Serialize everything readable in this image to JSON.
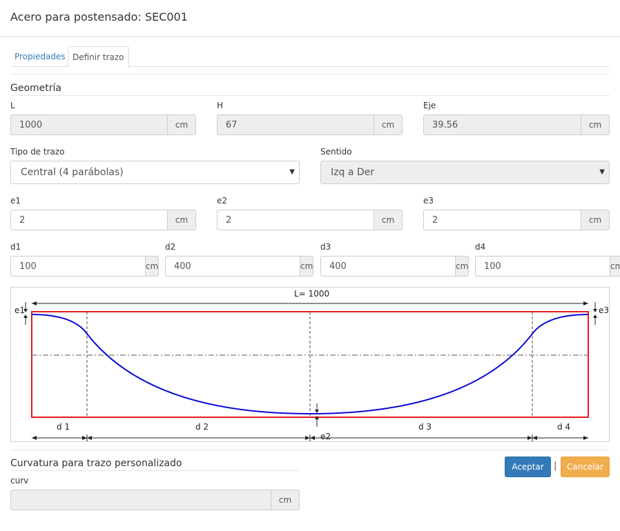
{
  "dialog": {
    "title": "Acero para postensado: SEC001"
  },
  "tabs": [
    {
      "label": "Propiedades",
      "active": false
    },
    {
      "label": "Definir trazo",
      "active": true
    }
  ],
  "geometry": {
    "section_title": "Geometría",
    "L": {
      "label": "L",
      "value": "1000",
      "unit": "cm"
    },
    "H": {
      "label": "H",
      "value": "67",
      "unit": "cm"
    },
    "Eje": {
      "label": "Eje",
      "value": "39.56",
      "unit": "cm"
    }
  },
  "trace": {
    "tipo_label": "Tipo de trazo",
    "tipo_value": "Central (4 parábolas)",
    "sentido_label": "Sentido",
    "sentido_value": "Izq a Der"
  },
  "eccentricities": [
    {
      "label": "e1",
      "value": "2",
      "unit": "cm"
    },
    {
      "label": "e2",
      "value": "2",
      "unit": "cm"
    },
    {
      "label": "e3",
      "value": "2",
      "unit": "cm"
    }
  ],
  "distances": [
    {
      "label": "d1",
      "value": "100",
      "unit": "cm"
    },
    {
      "label": "d2",
      "value": "400",
      "unit": "cm"
    },
    {
      "label": "d3",
      "value": "400",
      "unit": "cm"
    },
    {
      "label": "d4",
      "value": "100",
      "unit": "cm"
    }
  ],
  "diagram": {
    "length_label": "L= 1000",
    "labels": {
      "e1": "e1",
      "e2": "e2",
      "e3": "e3",
      "d1": "d 1",
      "d2": "d 2",
      "d3": "d 3",
      "d4": "d 4"
    },
    "colors": {
      "section": "#e31b1b",
      "tendon": "#0a0ad6",
      "axis": "#777777",
      "dim": "#222222"
    }
  },
  "custom": {
    "section_title": "Curvatura para trazo personalizado",
    "curv_label": "curv",
    "curv_value": "",
    "unit": "cm"
  },
  "buttons": {
    "accept": "Aceptar",
    "separator": "|",
    "cancel": "Cancelar"
  }
}
